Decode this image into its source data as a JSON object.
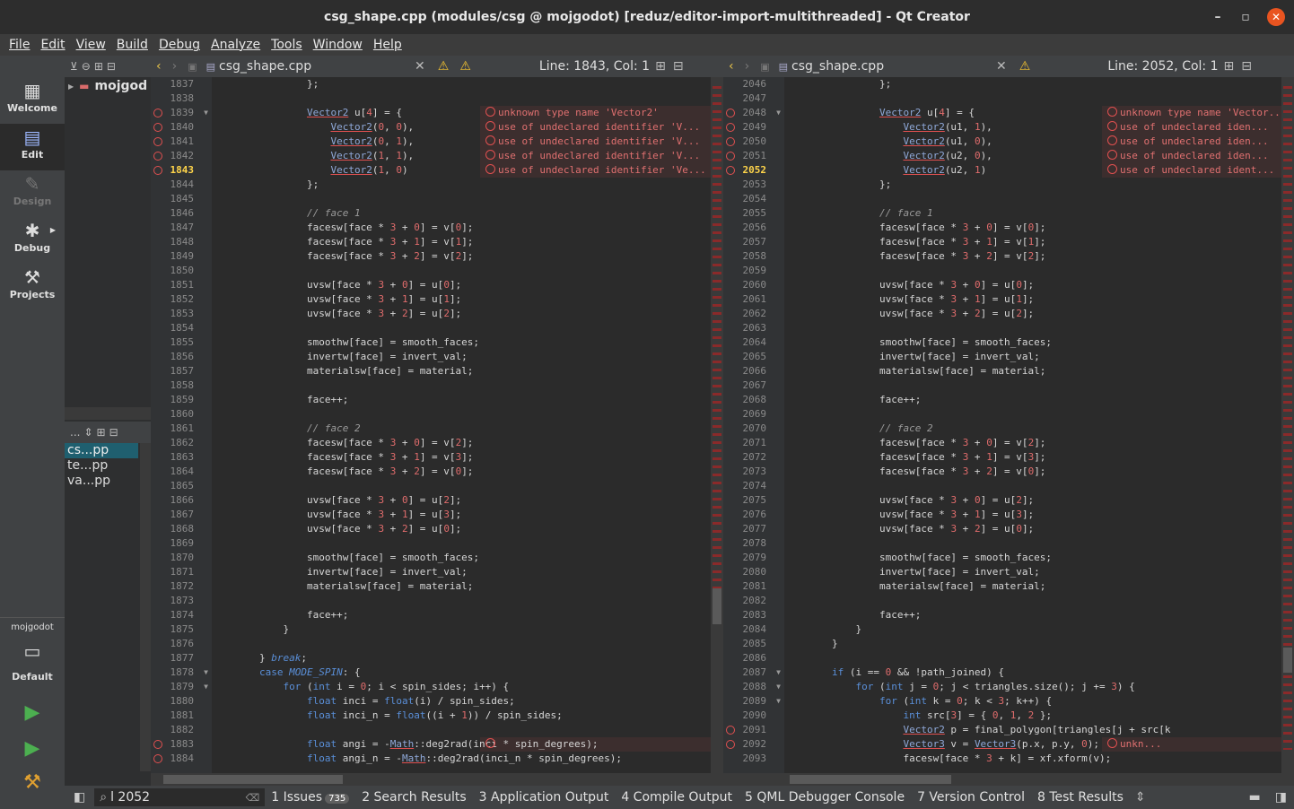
{
  "window": {
    "title": "csg_shape.cpp (modules/csg @ mojgodot) [reduz/editor-import-multithreaded] - Qt Creator"
  },
  "menu": [
    "File",
    "Edit",
    "View",
    "Build",
    "Debug",
    "Analyze",
    "Tools",
    "Window",
    "Help"
  ],
  "modes": [
    {
      "label": "Welcome",
      "icon": "grid-icon"
    },
    {
      "label": "Edit",
      "icon": "document-icon"
    },
    {
      "label": "Design",
      "icon": "pen-icon"
    },
    {
      "label": "Debug",
      "icon": "bug-icon"
    },
    {
      "label": "Projects",
      "icon": "wrench-icon"
    }
  ],
  "kit": {
    "project": "mojgodot",
    "name": "Default"
  },
  "project_tree": {
    "root": "mojgod"
  },
  "open_docs": {
    "selector": "...",
    "items": [
      "cs...pp",
      "te...pp",
      "va...pp"
    ]
  },
  "left_editor": {
    "file": "csg_shape.cpp",
    "position": "Line: 1843, Col: 1"
  },
  "right_editor": {
    "file": "csg_shape.cpp",
    "position": "Line: 2052, Col: 1"
  },
  "left_lines": [
    {
      "n": "1837",
      "t": "                };"
    },
    {
      "n": "1838",
      "t": ""
    },
    {
      "n": "1839",
      "t": "                Vector2 u[4] = {",
      "err": 1,
      "fold": 1,
      "msg": "unknown type name 'Vector2'"
    },
    {
      "n": "1840",
      "t": "                    Vector2(0, 0),",
      "err": 1,
      "msg": "use of undeclared identifier 'V..."
    },
    {
      "n": "1841",
      "t": "                    Vector2(0, 1),",
      "err": 1,
      "msg": "use of undeclared identifier 'V..."
    },
    {
      "n": "1842",
      "t": "                    Vector2(1, 1),",
      "err": 1,
      "msg": "use of undeclared identifier 'V..."
    },
    {
      "n": "1843",
      "t": "                    Vector2(1, 0)",
      "err": 1,
      "cur": 1,
      "msg": "use of undeclared identifier 'Ve..."
    },
    {
      "n": "1844",
      "t": "                };"
    },
    {
      "n": "1845",
      "t": ""
    },
    {
      "n": "1846",
      "t": "                // face 1"
    },
    {
      "n": "1847",
      "t": "                facesw[face * 3 + 0] = v[0];"
    },
    {
      "n": "1848",
      "t": "                facesw[face * 3 + 1] = v[1];"
    },
    {
      "n": "1849",
      "t": "                facesw[face * 3 + 2] = v[2];"
    },
    {
      "n": "1850",
      "t": ""
    },
    {
      "n": "1851",
      "t": "                uvsw[face * 3 + 0] = u[0];"
    },
    {
      "n": "1852",
      "t": "                uvsw[face * 3 + 1] = u[1];"
    },
    {
      "n": "1853",
      "t": "                uvsw[face * 3 + 2] = u[2];"
    },
    {
      "n": "1854",
      "t": ""
    },
    {
      "n": "1855",
      "t": "                smoothw[face] = smooth_faces;"
    },
    {
      "n": "1856",
      "t": "                invertw[face] = invert_val;"
    },
    {
      "n": "1857",
      "t": "                materialsw[face] = material;"
    },
    {
      "n": "1858",
      "t": ""
    },
    {
      "n": "1859",
      "t": "                face++;"
    },
    {
      "n": "1860",
      "t": ""
    },
    {
      "n": "1861",
      "t": "                // face 2"
    },
    {
      "n": "1862",
      "t": "                facesw[face * 3 + 0] = v[2];"
    },
    {
      "n": "1863",
      "t": "                facesw[face * 3 + 1] = v[3];"
    },
    {
      "n": "1864",
      "t": "                facesw[face * 3 + 2] = v[0];"
    },
    {
      "n": "1865",
      "t": ""
    },
    {
      "n": "1866",
      "t": "                uvsw[face * 3 + 0] = u[2];"
    },
    {
      "n": "1867",
      "t": "                uvsw[face * 3 + 1] = u[3];"
    },
    {
      "n": "1868",
      "t": "                uvsw[face * 3 + 2] = u[0];"
    },
    {
      "n": "1869",
      "t": ""
    },
    {
      "n": "1870",
      "t": "                smoothw[face] = smooth_faces;"
    },
    {
      "n": "1871",
      "t": "                invertw[face] = invert_val;"
    },
    {
      "n": "1872",
      "t": "                materialsw[face] = material;"
    },
    {
      "n": "1873",
      "t": ""
    },
    {
      "n": "1874",
      "t": "                face++;"
    },
    {
      "n": "1875",
      "t": "            }"
    },
    {
      "n": "1876",
      "t": ""
    },
    {
      "n": "1877",
      "t": "        } break;"
    },
    {
      "n": "1878",
      "t": "        case MODE_SPIN: {",
      "fold": 1
    },
    {
      "n": "1879",
      "t": "            for (int i = 0; i < spin_sides; i++) {",
      "fold": 1
    },
    {
      "n": "1880",
      "t": "                float inci = float(i) / spin_sides;"
    },
    {
      "n": "1881",
      "t": "                float inci_n = float((i + 1)) / spin_sides;"
    },
    {
      "n": "1882",
      "t": ""
    },
    {
      "n": "1883",
      "t": "                float angi = -Math::deg2rad(inci * spin_degrees);",
      "err": 1,
      "msg": ""
    },
    {
      "n": "1884",
      "t": "                float angi_n = -Math::deg2rad(inci_n * spin_degrees);",
      "err": 1
    }
  ],
  "right_lines": [
    {
      "n": "2046",
      "t": "                };"
    },
    {
      "n": "2047",
      "t": ""
    },
    {
      "n": "2048",
      "t": "                Vector2 u[4] = {",
      "err": 1,
      "fold": 1,
      "msg": "unknown type name 'Vector..."
    },
    {
      "n": "2049",
      "t": "                    Vector2(u1, 1),",
      "err": 1,
      "msg": "use of undeclared iden..."
    },
    {
      "n": "2050",
      "t": "                    Vector2(u1, 0),",
      "err": 1,
      "msg": "use of undeclared iden..."
    },
    {
      "n": "2051",
      "t": "                    Vector2(u2, 0),",
      "err": 1,
      "msg": "use of undeclared iden..."
    },
    {
      "n": "2052",
      "t": "                    Vector2(u2, 1)",
      "err": 1,
      "cur": 1,
      "msg": "use of undeclared ident..."
    },
    {
      "n": "2053",
      "t": "                };"
    },
    {
      "n": "2054",
      "t": ""
    },
    {
      "n": "2055",
      "t": "                // face 1"
    },
    {
      "n": "2056",
      "t": "                facesw[face * 3 + 0] = v[0];"
    },
    {
      "n": "2057",
      "t": "                facesw[face * 3 + 1] = v[1];"
    },
    {
      "n": "2058",
      "t": "                facesw[face * 3 + 2] = v[2];"
    },
    {
      "n": "2059",
      "t": ""
    },
    {
      "n": "2060",
      "t": "                uvsw[face * 3 + 0] = u[0];"
    },
    {
      "n": "2061",
      "t": "                uvsw[face * 3 + 1] = u[1];"
    },
    {
      "n": "2062",
      "t": "                uvsw[face * 3 + 2] = u[2];"
    },
    {
      "n": "2063",
      "t": ""
    },
    {
      "n": "2064",
      "t": "                smoothw[face] = smooth_faces;"
    },
    {
      "n": "2065",
      "t": "                invertw[face] = invert_val;"
    },
    {
      "n": "2066",
      "t": "                materialsw[face] = material;"
    },
    {
      "n": "2067",
      "t": ""
    },
    {
      "n": "2068",
      "t": "                face++;"
    },
    {
      "n": "2069",
      "t": ""
    },
    {
      "n": "2070",
      "t": "                // face 2"
    },
    {
      "n": "2071",
      "t": "                facesw[face * 3 + 0] = v[2];"
    },
    {
      "n": "2072",
      "t": "                facesw[face * 3 + 1] = v[3];"
    },
    {
      "n": "2073",
      "t": "                facesw[face * 3 + 2] = v[0];"
    },
    {
      "n": "2074",
      "t": ""
    },
    {
      "n": "2075",
      "t": "                uvsw[face * 3 + 0] = u[2];"
    },
    {
      "n": "2076",
      "t": "                uvsw[face * 3 + 1] = u[3];"
    },
    {
      "n": "2077",
      "t": "                uvsw[face * 3 + 2] = u[0];"
    },
    {
      "n": "2078",
      "t": ""
    },
    {
      "n": "2079",
      "t": "                smoothw[face] = smooth_faces;"
    },
    {
      "n": "2080",
      "t": "                invertw[face] = invert_val;"
    },
    {
      "n": "2081",
      "t": "                materialsw[face] = material;"
    },
    {
      "n": "2082",
      "t": ""
    },
    {
      "n": "2083",
      "t": "                face++;"
    },
    {
      "n": "2084",
      "t": "            }"
    },
    {
      "n": "2085",
      "t": "        }"
    },
    {
      "n": "2086",
      "t": ""
    },
    {
      "n": "2087",
      "t": "        if (i == 0 && !path_joined) {",
      "fold": 1
    },
    {
      "n": "2088",
      "t": "            for (int j = 0; j < triangles.size(); j += 3) {",
      "fold": 1
    },
    {
      "n": "2089",
      "t": "                for (int k = 0; k < 3; k++) {",
      "fold": 1
    },
    {
      "n": "2090",
      "t": "                    int src[3] = { 0, 1, 2 };"
    },
    {
      "n": "2091",
      "t": "                    Vector2 p = final_polygon[triangles[j + src[k",
      "err": 1
    },
    {
      "n": "2092",
      "t": "                    Vector3 v = Vector3(p.x, p.y, 0);",
      "err": 1,
      "msg": "unkn..."
    },
    {
      "n": "2093",
      "t": "                    facesw[face * 3 + k] = xf.xform(v);"
    }
  ],
  "statusbar": {
    "locator": "l 2052",
    "tabs": [
      {
        "label": "1  Issues",
        "badge": "735"
      },
      {
        "label": "2  Search Results"
      },
      {
        "label": "3  Application Output"
      },
      {
        "label": "4  Compile Output"
      },
      {
        "label": "5  QML Debugger Console"
      },
      {
        "label": "7  Version Control"
      },
      {
        "label": "8  Test Results"
      }
    ]
  },
  "colors": {
    "error": "#e05050",
    "keyword": "#5a8fd8",
    "background": "#2b2b2b",
    "accent": "#e95420"
  }
}
